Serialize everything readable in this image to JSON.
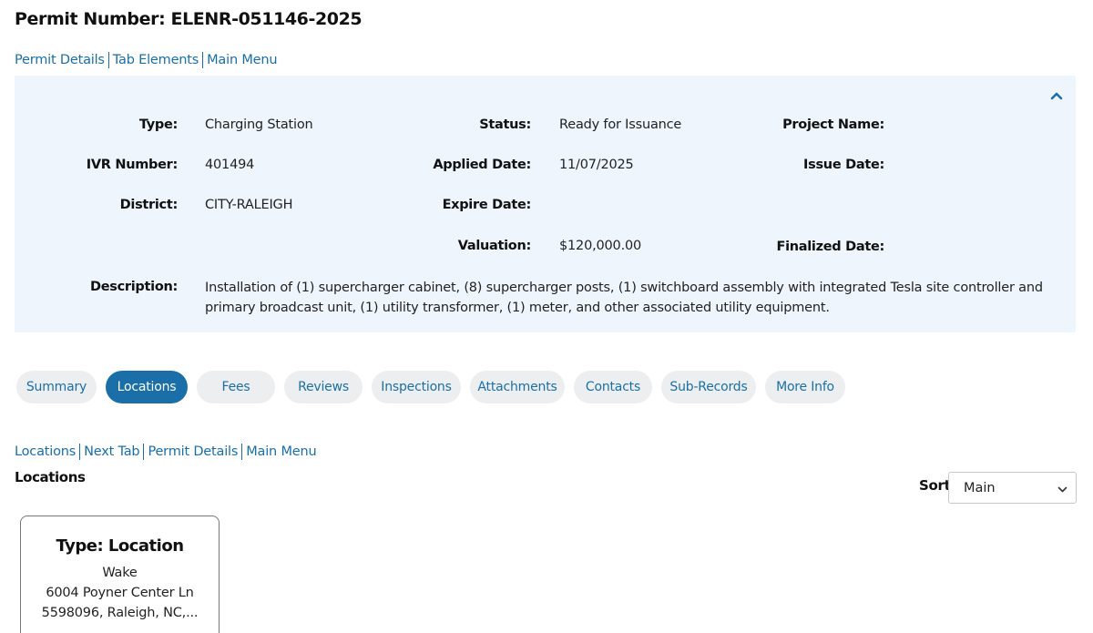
{
  "page": {
    "title": "Permit Number: ELENR-051146-2025"
  },
  "top_links": [
    "Permit Details",
    "Tab Elements",
    "Main Menu"
  ],
  "details": {
    "type_label": "Type:",
    "type_value": "Charging Station",
    "ivr_label": "IVR Number:",
    "ivr_value": "401494",
    "district_label": "District:",
    "district_value": "CITY-RALEIGH",
    "description_label": "Description:",
    "description_value": "Installation of (1) supercharger cabinet, (8) supercharger posts, (1) switchboard assembly with integrated Tesla site controller and primary broadcast unit, (1) utility transformer, (1) meter, and other associated utility equipment.",
    "status_label": "Status:",
    "status_value": "Ready for Issuance",
    "applied_label": "Applied Date:",
    "applied_value": "11/07/2025",
    "expire_label": "Expire Date:",
    "expire_value": "",
    "valuation_label": "Valuation:",
    "valuation_value": "$120,000.00",
    "project_label": "Project Name:",
    "project_value": "",
    "issue_label": "Issue Date:",
    "issue_value": "",
    "finalized_label": "Finalized Date:",
    "finalized_value": "",
    "collapse_icon": "chevron-up-icon"
  },
  "tabs": [
    "Summary",
    "Locations",
    "Fees",
    "Reviews",
    "Inspections",
    "Attachments",
    "Contacts",
    "Sub-Records",
    "More Info"
  ],
  "active_tab": "Locations",
  "tab_links": [
    "Locations",
    "Next Tab",
    "Permit Details",
    "Main Menu"
  ],
  "section": {
    "title": "Locations"
  },
  "sort": {
    "label": "Sort",
    "selected": "Main"
  },
  "location_card": {
    "title": "Type: Location",
    "line1": "Wake",
    "line2": "6004 Poyner Center Ln",
    "line3": "5598096, Raleigh, NC,..."
  },
  "colors": {
    "link": "#1a6fa8",
    "panel_bg": "#eef5fc",
    "tab_bg": "#eceeef",
    "tab_active_bg": "#1a6fa8"
  }
}
